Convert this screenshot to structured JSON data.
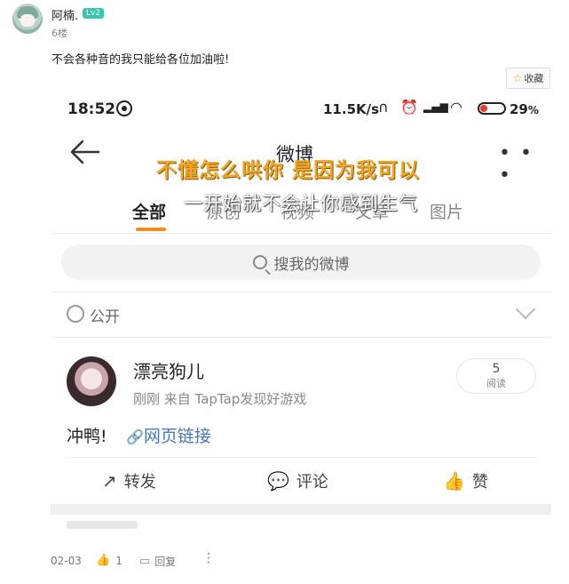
{
  "post": {
    "username": "阿楠.",
    "level": "Lv2",
    "floor": "6楼",
    "content": "不会各种音的我只能给各位加油啦!",
    "favorite_label": "收藏",
    "date": "02-03",
    "like_count": "1",
    "reply_label": "回复",
    "more_label": "⋮"
  },
  "screenshot": {
    "status": {
      "time": "18:52",
      "net_speed": "11.5K/s",
      "battery_pct": "29",
      "battery_unit": "%",
      "battery_level": 0.29
    },
    "nav": {
      "title": "微博",
      "more": "• • •"
    },
    "subtitles": {
      "line1": "不懂怎么哄你 是因为我可以",
      "line2": "一开始就不会让你感到生气"
    },
    "tabs": [
      {
        "label": "全部",
        "active": true
      },
      {
        "label": "原创",
        "active": false
      },
      {
        "label": "视频",
        "active": false
      },
      {
        "label": "文章",
        "active": false
      },
      {
        "label": "图片",
        "active": false
      }
    ],
    "search_placeholder": "搜我的微博",
    "visibility_label": "公开",
    "weibo": {
      "author": "漂亮狗儿",
      "meta": "刚刚  来自 TapTap发现好游戏",
      "read_count": "5",
      "read_label": "阅读",
      "text": "冲鸭!",
      "link_label": "网页链接"
    },
    "actions": [
      {
        "label": "转发",
        "icon": "share-icon"
      },
      {
        "label": "评论",
        "icon": "comment-icon"
      },
      {
        "label": "赞",
        "icon": "thumbs-up-icon"
      }
    ]
  },
  "colors": {
    "accent_orange": "#f28b1d",
    "subtitle_yellow": "#f0a628",
    "link_blue": "#4a77c4",
    "level_badge": "#35c6ad"
  }
}
